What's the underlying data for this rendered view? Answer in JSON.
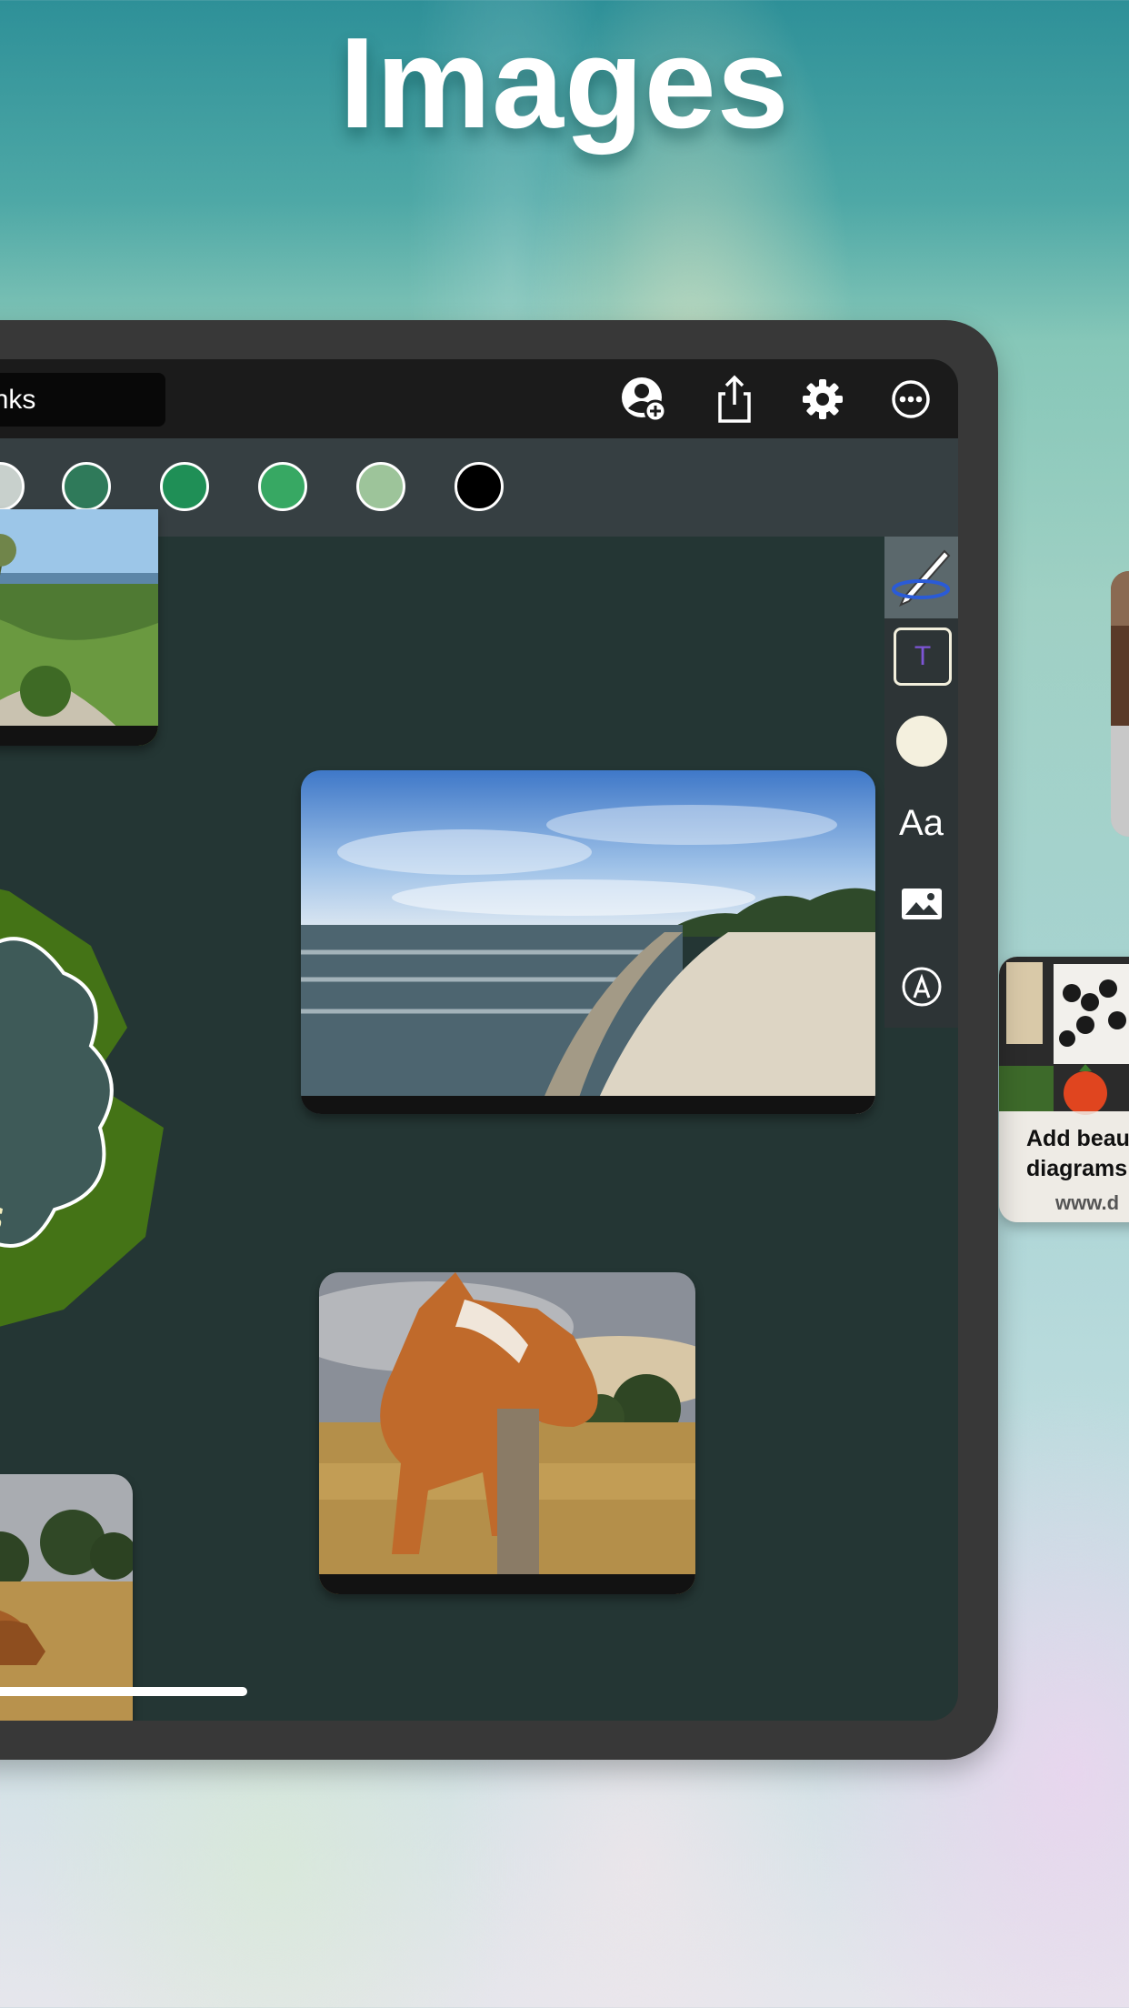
{
  "headline": "Images",
  "board": {
    "title": "eblinks"
  },
  "toolbar": {
    "icons": [
      "add-collaborator-icon",
      "share-icon",
      "settings-icon",
      "more-icon"
    ]
  },
  "palette": {
    "colors": [
      "#c8d0cc",
      "#2f7a5a",
      "#1f8f56",
      "#37a863",
      "#9dc49a",
      "#000000"
    ]
  },
  "tools": {
    "items": [
      "pen-tool-icon",
      "text-box-icon",
      "color-circle-icon",
      "font-icon",
      "image-icon",
      "shape-icon"
    ],
    "font_label": "Aa",
    "text_box_glyph": "T"
  },
  "sticky_note": {
    "lines": [
      "os",
      "l",
      "nks"
    ]
  },
  "link_card": {
    "title_line1": "Add beau",
    "title_line2": "diagrams",
    "url": "www.d"
  }
}
